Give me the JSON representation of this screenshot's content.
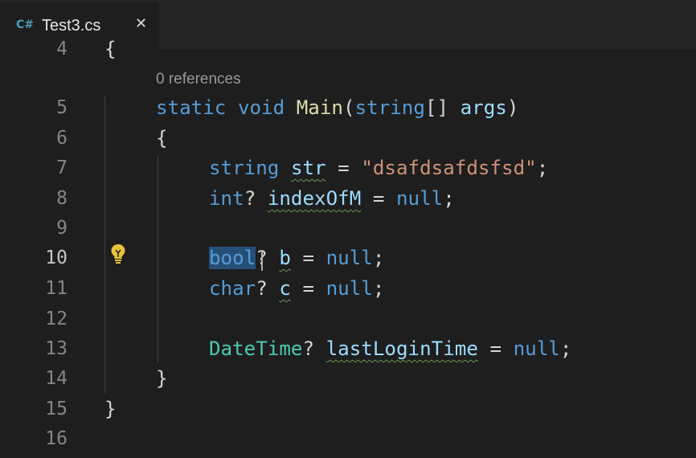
{
  "tab": {
    "icon_label": "C#",
    "title": "Test3.cs",
    "close_glyph": "✕"
  },
  "editor": {
    "partial_line_number": "4",
    "partial_line_text": "{",
    "codelens": "0 references",
    "active_line": 10,
    "lines": [
      {
        "num": "5",
        "tokens": [
          "static",
          "void",
          "Main",
          "(",
          "string",
          "[] ",
          "args",
          ")"
        ]
      },
      {
        "num": "6",
        "tokens": [
          "{"
        ]
      },
      {
        "num": "7",
        "tokens": [
          "string",
          "str",
          " = ",
          "\"dsafdsafdsfsd\"",
          ";"
        ]
      },
      {
        "num": "8",
        "tokens": [
          "int",
          "? ",
          "indexOfM",
          " = ",
          "null",
          ";"
        ]
      },
      {
        "num": "9",
        "tokens": []
      },
      {
        "num": "10",
        "tokens": [
          "bool",
          "? ",
          "b",
          " = ",
          "null",
          ";"
        ]
      },
      {
        "num": "11",
        "tokens": [
          "char",
          "? ",
          "c",
          " = ",
          "null",
          ";"
        ]
      },
      {
        "num": "12",
        "tokens": []
      },
      {
        "num": "13",
        "tokens": [
          "DateTime",
          "? ",
          "lastLoginTime",
          " = ",
          "null",
          ";"
        ]
      },
      {
        "num": "14",
        "tokens": [
          "}"
        ]
      },
      {
        "num": "15",
        "tokens": [
          "}"
        ]
      },
      {
        "num": "16",
        "tokens": []
      }
    ]
  },
  "icons": {
    "lightbulb": "lightbulb-icon"
  },
  "colors": {
    "keyword": "#569cd6",
    "function": "#dcdcaa",
    "variable": "#9cdcfe",
    "string": "#ce9178",
    "type": "#4ec9b0",
    "lightbulb": "#e8c33d"
  }
}
